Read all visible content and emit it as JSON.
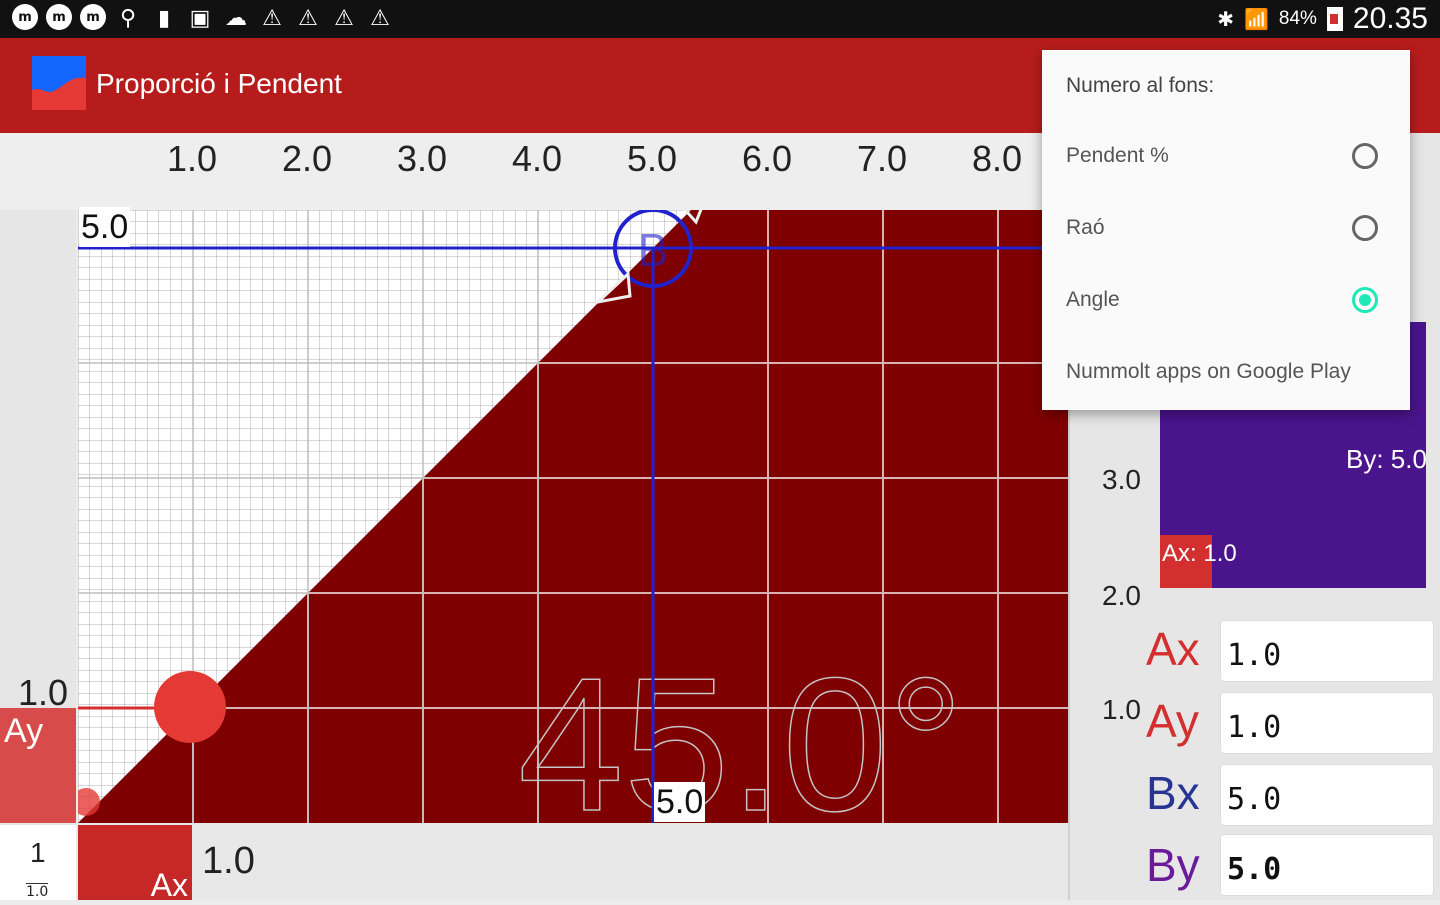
{
  "status_bar": {
    "battery": "84%",
    "time": "20.35"
  },
  "app": {
    "title": "Proporció i Pendent",
    "logo_icon": "app-logo-icon"
  },
  "graph": {
    "top_ticks": [
      "1.0",
      "2.0",
      "3.0",
      "4.0",
      "5.0",
      "6.0",
      "7.0",
      "8.0"
    ],
    "left_tick": "1.0",
    "y_marker_label": "5.0",
    "x_marker_label": "5.0",
    "point_b_label": "B",
    "background_number": "45.0°",
    "ay_label": "Ay",
    "ax_label": "Ax",
    "ratio_top": "1",
    "ratio_bottom": "1.0",
    "bottom_value": "1.0"
  },
  "right_panel": {
    "ticks": [
      "3.0",
      "2.0",
      "1.0"
    ],
    "mini_by": "By: 5.0",
    "mini_ax": "Ax: 1.0",
    "fields": [
      {
        "label": "Ax",
        "value": "1.0",
        "color": "#d32f2f"
      },
      {
        "label": "Ay",
        "value": "1.0",
        "color": "#d32f2f"
      },
      {
        "label": "Bx",
        "value": "5.0",
        "color": "#283593"
      },
      {
        "label": "By",
        "value": "5.0",
        "color": "#6a1b9a"
      }
    ]
  },
  "menu": {
    "header": "Numero al fons:",
    "items": [
      {
        "label": "Pendent %",
        "checked": false
      },
      {
        "label": "Raó",
        "checked": false
      },
      {
        "label": "Angle",
        "checked": true
      }
    ],
    "footer": "Nummolt apps on Google Play"
  },
  "colors": {
    "appbar": "#b71c1c",
    "fill": "#7f0000",
    "accent": "#1de9b6",
    "marker": "#2222cc"
  }
}
